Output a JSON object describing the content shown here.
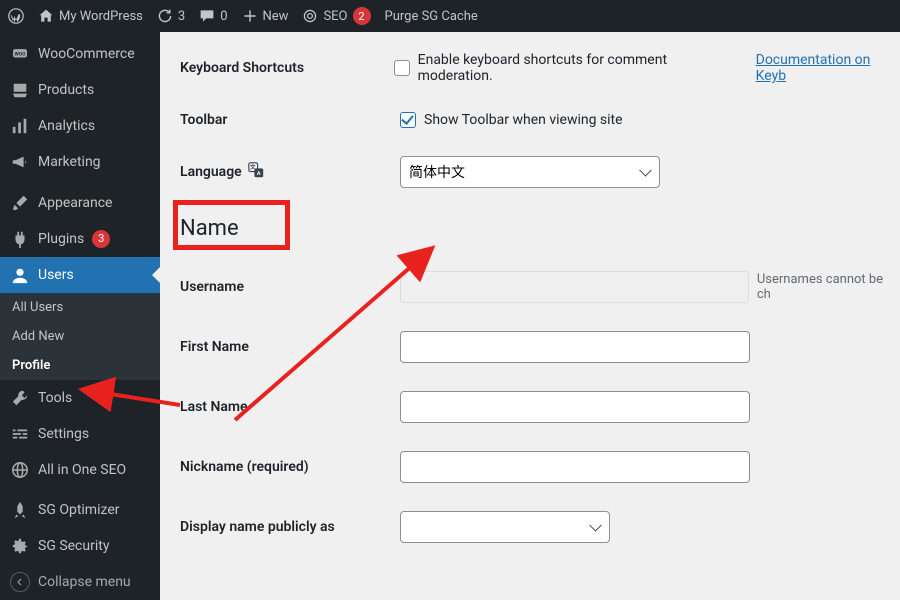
{
  "adminbar": {
    "site_name": "My WordPress",
    "updates_count": "3",
    "comments_count": "0",
    "new_label": "New",
    "seo_label": "SEO",
    "seo_count": "2",
    "purge_label": "Purge SG Cache"
  },
  "sidemenu": {
    "woocommerce": "WooCommerce",
    "products": "Products",
    "analytics": "Analytics",
    "marketing": "Marketing",
    "appearance": "Appearance",
    "plugins": "Plugins",
    "plugins_badge": "3",
    "users": "Users",
    "users_sub": {
      "all": "All Users",
      "add": "Add New",
      "profile": "Profile"
    },
    "tools": "Tools",
    "settings": "Settings",
    "aioseo": "All in One SEO",
    "sgoptimizer": "SG Optimizer",
    "sgsecurity": "SG Security",
    "collapse": "Collapse menu"
  },
  "profile": {
    "kb_shortcuts_label": "Keyboard Shortcuts",
    "kb_shortcuts_text": "Enable keyboard shortcuts for comment moderation.",
    "kb_doc_link": "Documentation on Keyb",
    "toolbar_label": "Toolbar",
    "toolbar_text": "Show Toolbar when viewing site",
    "language_label": "Language",
    "language_value": "简体中文",
    "section_name": "Name",
    "username_label": "Username",
    "username_hint": "Usernames cannot be ch",
    "firstname_label": "First Name",
    "lastname_label": "Last Name",
    "nickname_label": "Nickname (required)",
    "displayname_label": "Display name publicly as"
  }
}
